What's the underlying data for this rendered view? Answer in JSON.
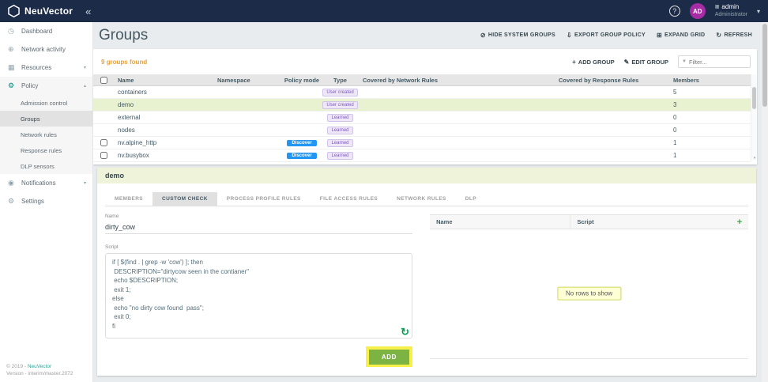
{
  "colors": {
    "topbar_bg": "#1c2b47",
    "accent_teal": "#26a69a",
    "avatar_bg": "#a62ca6",
    "count_text": "#e8a33d",
    "discover_badge": "#2196f3",
    "type_badge_bg": "#ede7f6",
    "selected_row_bg": "#e9f2d0",
    "add_button_bg": "#7cb342",
    "highlight_yellow": "#f7f04a"
  },
  "icons": {
    "collapse": "«",
    "help": "?",
    "chevron_down": "▾",
    "chevron_up": "▴",
    "org": "▦",
    "dashboard": "◷",
    "network": "⊕",
    "resources": "▦",
    "policy": "⚙",
    "notifications": "◉",
    "settings": "⚙",
    "hide": "⊘",
    "export": "⇩",
    "expand": "⊞",
    "refresh": "↻",
    "add": "+",
    "edit": "✎",
    "filter": "▼",
    "plus": "+",
    "script_refresh": "↻",
    "scroll_down": "▾"
  },
  "topbar": {
    "brand": "NeuVector",
    "avatar_initials": "AD",
    "user_name": "admin",
    "user_role": "Administrator"
  },
  "sidebar": {
    "items": {
      "dashboard": "Dashboard",
      "network_activity": "Network activity",
      "resources": "Resources",
      "policy": "Policy",
      "admission_control": "Admission control",
      "groups": "Groups",
      "network_rules": "Network rules",
      "response_rules": "Response rules",
      "dlp_sensors": "DLP sensors",
      "notifications": "Notifications",
      "settings": "Settings"
    },
    "footer_copyright": "© 2019 - ",
    "footer_brand": "NeuVector",
    "footer_version": "Version - interim/master.2072"
  },
  "main": {
    "title": "Groups",
    "actions": {
      "hide_system_groups": "HIDE SYSTEM GROUPS",
      "export_group_policy": "EXPORT GROUP POLICY",
      "expand_grid": "EXPAND GRID",
      "refresh": "REFRESH"
    },
    "toolbar": {
      "count": "9 groups found",
      "add_group": "ADD GROUP",
      "edit_group": "EDIT GROUP",
      "filter_placeholder": "Filter..."
    },
    "table": {
      "headers": {
        "name": "Name",
        "namespace": "Namespace",
        "policy_mode": "Policy mode",
        "type": "Type",
        "covered_network": "Covered by Network Rules",
        "covered_response": "Covered by Response Rules",
        "members": "Members"
      },
      "rows": [
        {
          "name": "containers",
          "namespace": "",
          "policy_mode": "",
          "type": "User created",
          "covered_network": "",
          "covered_response": "",
          "members": "5"
        },
        {
          "name": "demo",
          "namespace": "",
          "policy_mode": "",
          "type": "User created",
          "covered_network": "",
          "covered_response": "",
          "members": "3"
        },
        {
          "name": "external",
          "namespace": "",
          "policy_mode": "",
          "type": "Learned",
          "covered_network": "",
          "covered_response": "",
          "members": "0"
        },
        {
          "name": "nodes",
          "namespace": "",
          "policy_mode": "",
          "type": "Learned",
          "covered_network": "",
          "covered_response": "",
          "members": "0"
        },
        {
          "name": "nv.alpine_http",
          "namespace": "",
          "policy_mode": "Discover",
          "type": "Learned",
          "covered_network": "",
          "covered_response": "",
          "members": "1"
        },
        {
          "name": "nv.busybox",
          "namespace": "",
          "policy_mode": "Discover",
          "type": "Learned",
          "covered_network": "",
          "covered_response": "",
          "members": "1"
        }
      ]
    }
  },
  "detail": {
    "group_name": "demo",
    "tabs": [
      "MEMBERS",
      "CUSTOM CHECK",
      "PROCESS PROFILE RULES",
      "FILE ACCESS RULES",
      "NETWORK RULES",
      "DLP"
    ],
    "active_tab": "CUSTOM CHECK",
    "form": {
      "name_label": "Name",
      "name_value": "dirty_cow",
      "script_label": "Script",
      "script_value": "if [ $(find . | grep -w 'cow') ]; then\n DESCRIPTION=\"dirtycow seen in the contianer\"\n echo $DESCRIPTION;\n exit 1;\nelse\n echo \"no dirty cow found  pass\";\n exit 0;\nfi",
      "add_button": "ADD"
    },
    "scripts_table": {
      "name_header": "Name",
      "script_header": "Script",
      "empty_message": "No rows to show"
    }
  }
}
